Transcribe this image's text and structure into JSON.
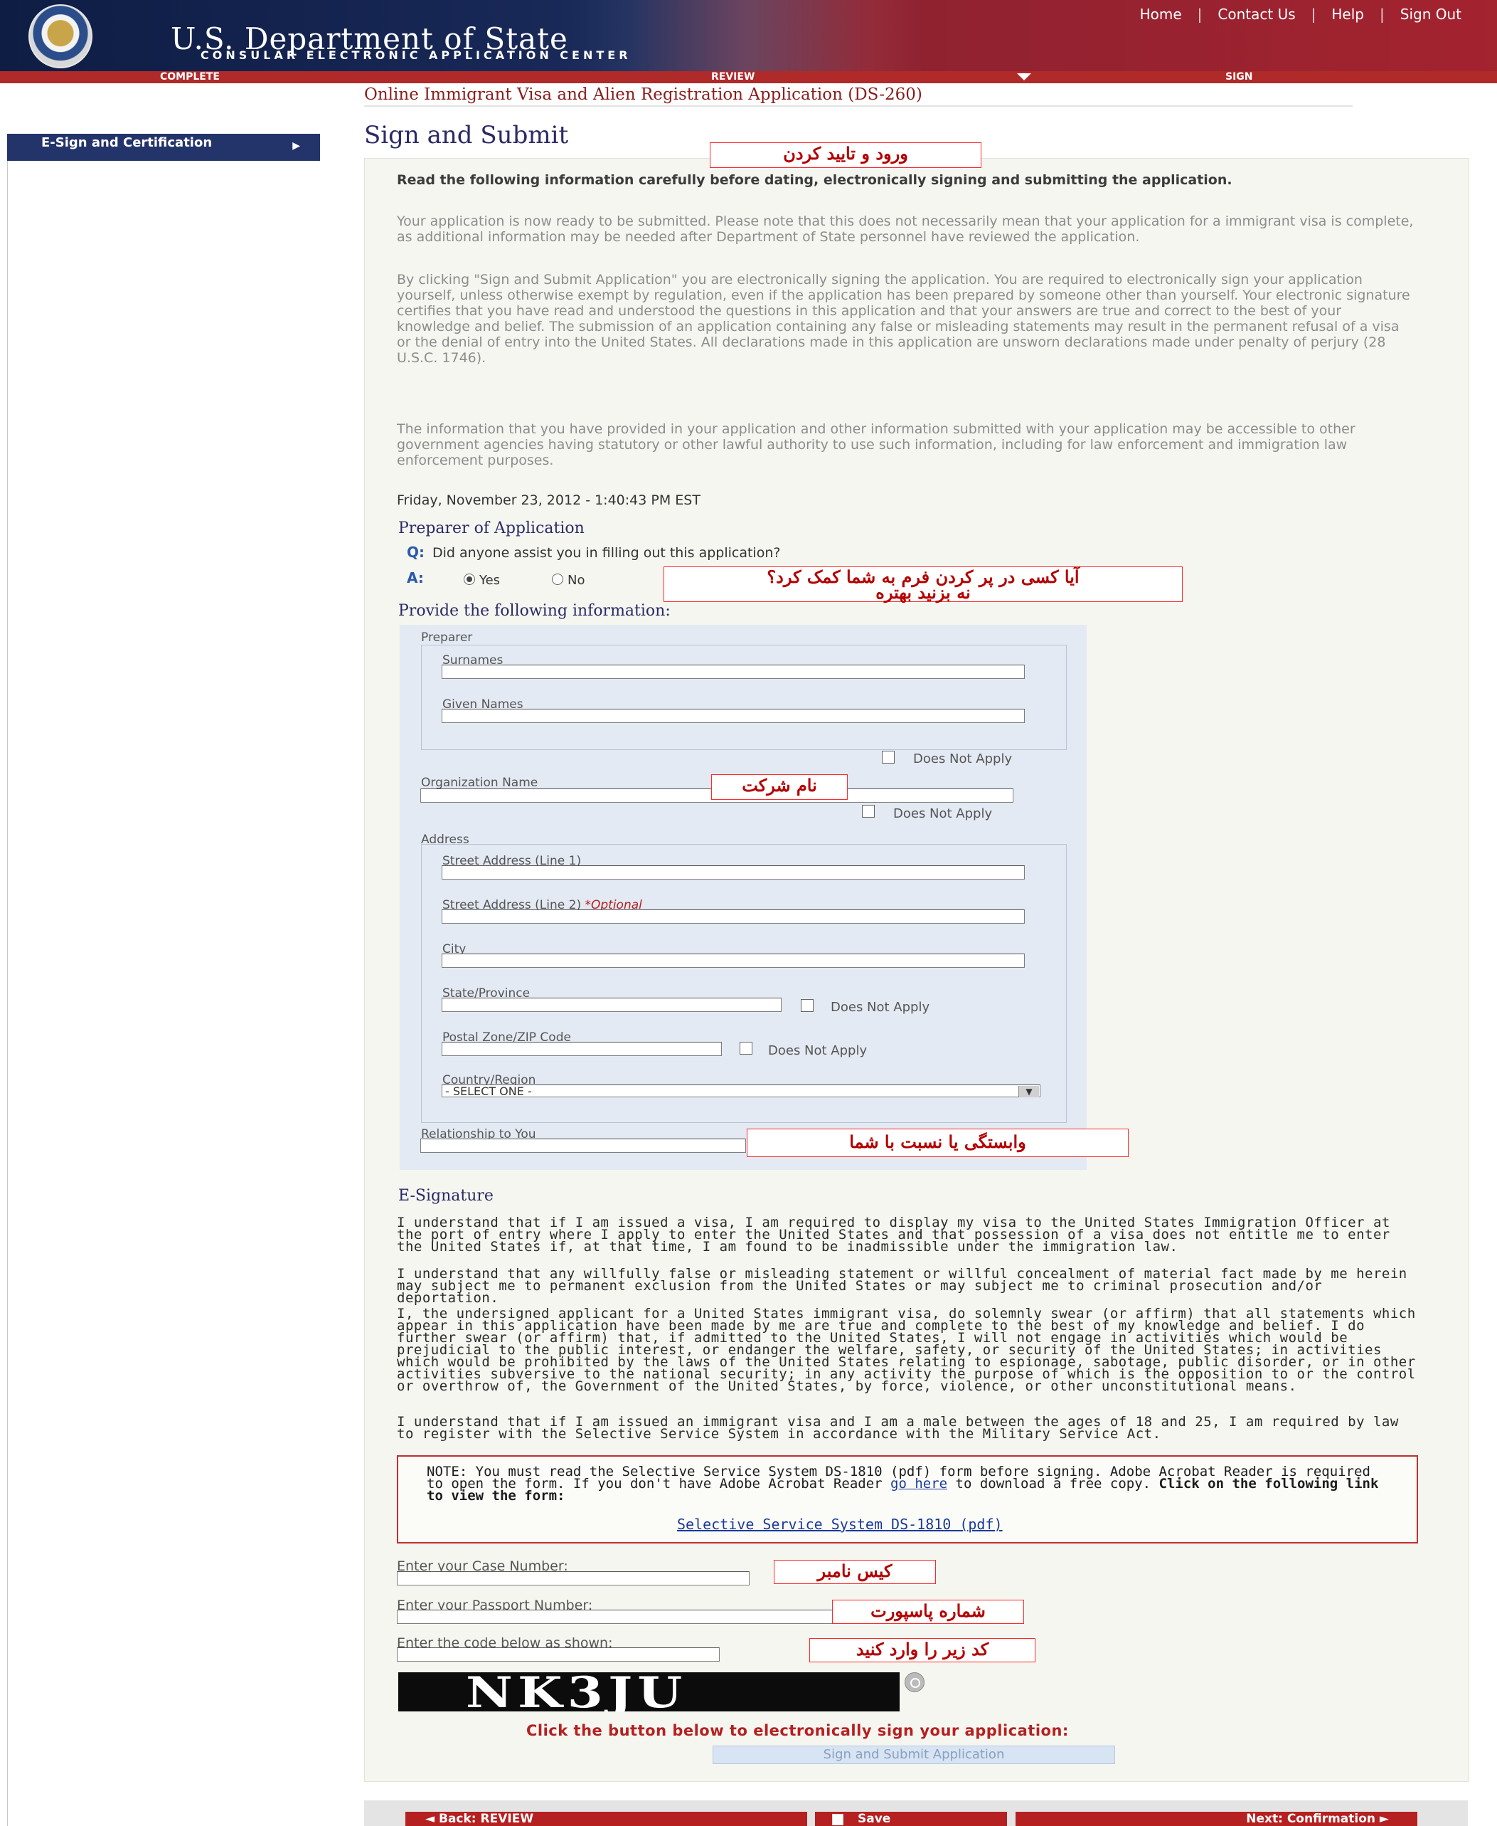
{
  "header": {
    "title": "U.S. Department of State",
    "subtitle": "CONSULAR ELECTRONIC APPLICATION CENTER",
    "nav": [
      "Home",
      "Contact Us",
      "Help",
      "Sign Out"
    ]
  },
  "steps": [
    "COMPLETE",
    "REVIEW",
    "SIGN"
  ],
  "sidebar": {
    "item": "E-Sign and Certification"
  },
  "app_title": "Online Immigrant Visa and Alien Registration Application (DS-260)",
  "page_title": "Sign and Submit",
  "annotations": {
    "sign_confirm": "ورود و تایید کردن",
    "assist_q": "آیا کسی در پر کردن فرم به شما کمک کرد؟",
    "assist_tip": "نه بزنید بهتره",
    "org": "نام شرکت",
    "relationship": "وابستگی  یا نسبت با شما",
    "case": "کیس نامبر",
    "passport": "شماره پاسپورت",
    "code": "کد زیر را وارد کنید"
  },
  "intro": {
    "heading": "Read the following information carefully before dating, electronically signing and submitting the application.",
    "p1": "Your application is now ready to be submitted. Please note that this does not necessarily mean that your application for a immigrant visa is complete, as additional information may be needed after Department of State personnel have reviewed the application.",
    "p2": "By clicking \"Sign and Submit Application\" you are electronically signing the application. You are required to electronically sign your application yourself, unless otherwise exempt by regulation, even if the application has been prepared by someone other than yourself. Your electronic signature certifies that you have read and understood the questions in this application and that your answers are true and correct to the best of your knowledge and belief. The submission of an application containing any false or misleading statements may result in the permanent refusal of a visa or the denial of entry into the United States. All declarations made in this application are unsworn declarations made under penalty of perjury (28 U.S.C. 1746).",
    "p3": "The information that you have provided in your application and other information submitted with your application may be accessible to other government agencies having statutory or other lawful authority to use such information, including for law enforcement and immigration law enforcement purposes.",
    "date": "Friday, November 23, 2012 - 1:40:43 PM EST"
  },
  "preparer": {
    "title": "Preparer of Application",
    "q_label": "Q:",
    "question": "Did anyone assist you in filling out this application?",
    "a_label": "A:",
    "yes": "Yes",
    "no": "No",
    "provide": "Provide the following information:",
    "preparer_label": "Preparer",
    "surnames": "Surnames",
    "given_names": "Given Names",
    "dna": "Does Not Apply",
    "org_name": "Organization Name",
    "address": "Address",
    "street1": "Street Address (Line 1)",
    "street2": "Street Address (Line 2)",
    "optional": "*Optional",
    "city": "City",
    "state": "State/Province",
    "zip": "Postal Zone/ZIP Code",
    "country": "Country/Region",
    "country_value": "- SELECT ONE -",
    "relationship": "Relationship to You"
  },
  "esig": {
    "title": "E-Signature",
    "p1": "I understand that if I am issued a visa, I am required to display my visa to the United States Immigration Officer at the port of entry where I apply to enter the United States and that possession of a visa does not entitle me to enter the United States if, at that time, I am found to be inadmissible under the immigration law.",
    "p2": "I understand that any willfully false or misleading statement or willful concealment of material fact made by me herein may subject me to permanent exclusion from the United States or may subject me to criminal prosecution and/or deportation.",
    "p3": "I, the undersigned applicant for a United States immigrant visa, do solemnly swear (or affirm) that all statements which appear in this application have been made by me are true and complete to the best of my knowledge and belief. I do further swear (or affirm) that, if admitted to the United States, I will not engage in activities which would be prejudicial to the public interest, or endanger the welfare, safety, or security of the United States; in activities which would be prohibited by the laws of the United States relating to espionage, sabotage, public disorder, or in other activities subversive to the national security; in any activity the purpose of which is the opposition to or the control or overthrow of, the Government of the United States, by force, violence, or other unconstitutional means.",
    "p4": "I understand that if I am issued an immigrant visa and I am a male between the ages of 18 and 25, I am required by law to register with the Selective Service System in accordance with the Military Service Act."
  },
  "note": {
    "text_a": "NOTE: You must read the Selective Service System DS-1810 (pdf) form before signing. Adobe Acrobat Reader is required to open the form. If you don't have Adobe Acrobat Reader ",
    "link": "go here",
    "text_b": " to download a free copy.",
    "bold": "Click on the following link to view the form:",
    "form_link": "Selective Service System DS-1810 (pdf)"
  },
  "fields": {
    "case": "Enter your Case Number:",
    "passport": "Enter your Passport Number:",
    "code": "Enter the code below as shown:"
  },
  "captcha": "NK3JU",
  "instruction": "Click the button below to electronically sign your application:",
  "submit": "Sign and Submit Application",
  "bottom": {
    "back": "◄ Back: REVIEW",
    "save": "Save",
    "next": "Next: Confirmation ►"
  }
}
